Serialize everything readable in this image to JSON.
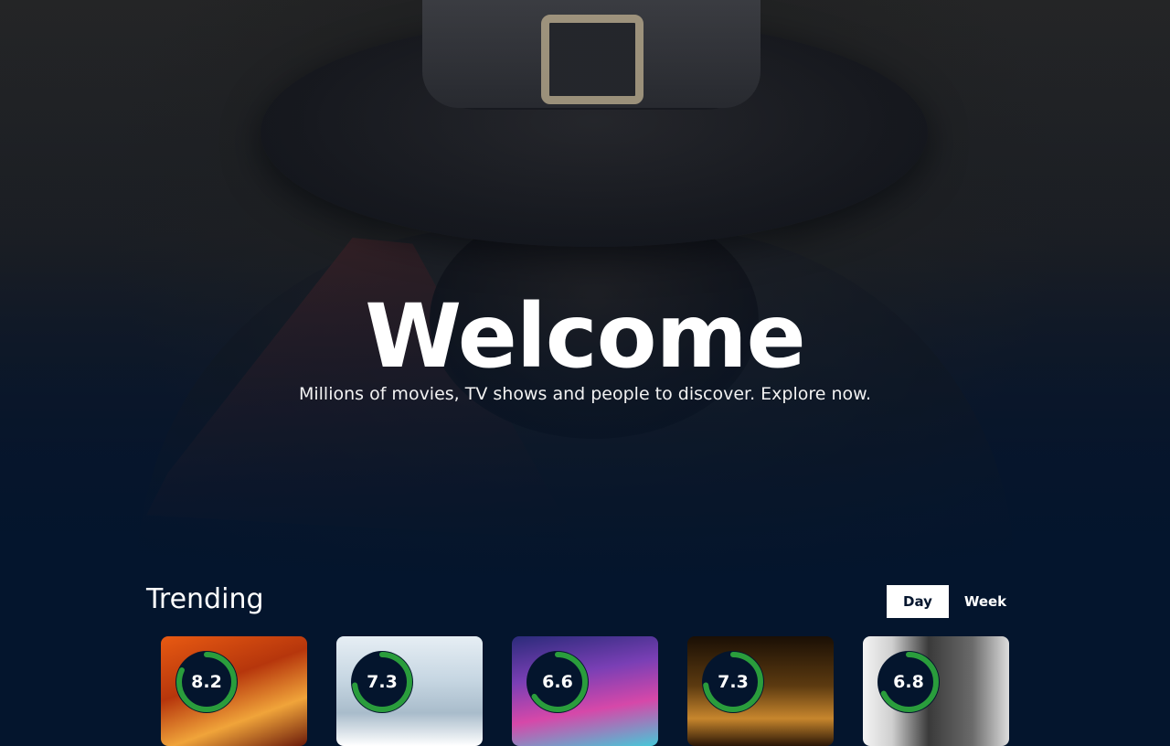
{
  "hero": {
    "title": "Welcome",
    "subtitle": "Millions of movies, TV shows and people to discover. Explore now."
  },
  "trending": {
    "title": "Trending",
    "tabs": [
      {
        "label": "Day",
        "active": true
      },
      {
        "label": "Week",
        "active": false
      }
    ],
    "items": [
      {
        "rating": "8.2",
        "progress": 0.82
      },
      {
        "rating": "7.3",
        "progress": 0.73
      },
      {
        "rating": "6.6",
        "progress": 0.66
      },
      {
        "rating": "7.3",
        "progress": 0.73
      },
      {
        "rating": "6.8",
        "progress": 0.68
      }
    ]
  },
  "colors": {
    "background": "#04152d",
    "rating_ring": "#2a9d3c",
    "rating_fill": "#04152d"
  }
}
